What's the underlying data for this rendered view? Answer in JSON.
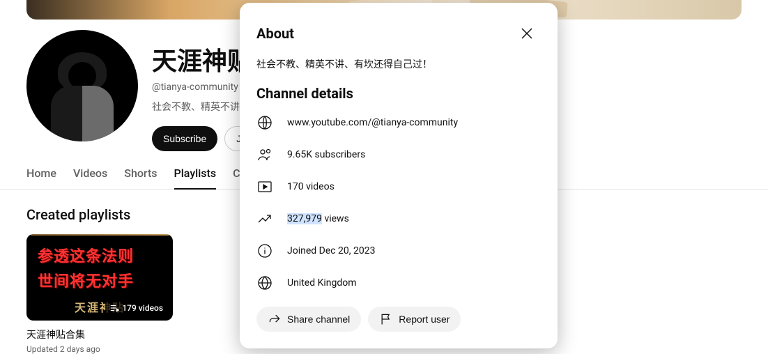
{
  "channel": {
    "name": "天涯神贴",
    "handle": "@tianya-community",
    "tagline": "社会不教、精英不讲、",
    "subscribe_label": "Subscribe",
    "join_label": "Join"
  },
  "tabs": {
    "home": "Home",
    "videos": "Videos",
    "shorts": "Shorts",
    "playlists": "Playlists",
    "more": "C"
  },
  "section": {
    "created_playlists": "Created playlists"
  },
  "playlist": {
    "thumb_line1": "参透这条法则",
    "thumb_line2": "世间将无对手",
    "thumb_footer": "天涯神贴",
    "video_count": "179 videos",
    "title": "天涯神贴合集",
    "meta": "Updated 2 days ago"
  },
  "modal": {
    "about_label": "About",
    "about_text": "社会不教、精英不讲、有坎还得自己过！",
    "details_label": "Channel details",
    "url": "www.youtube.com/@tianya-community",
    "subscribers": "9.65K subscribers",
    "videos": "170 videos",
    "views_number": "327,979",
    "views_suffix": " views",
    "joined": "Joined Dec 20, 2023",
    "location": "United Kingdom",
    "share_label": "Share channel",
    "report_label": "Report user"
  }
}
